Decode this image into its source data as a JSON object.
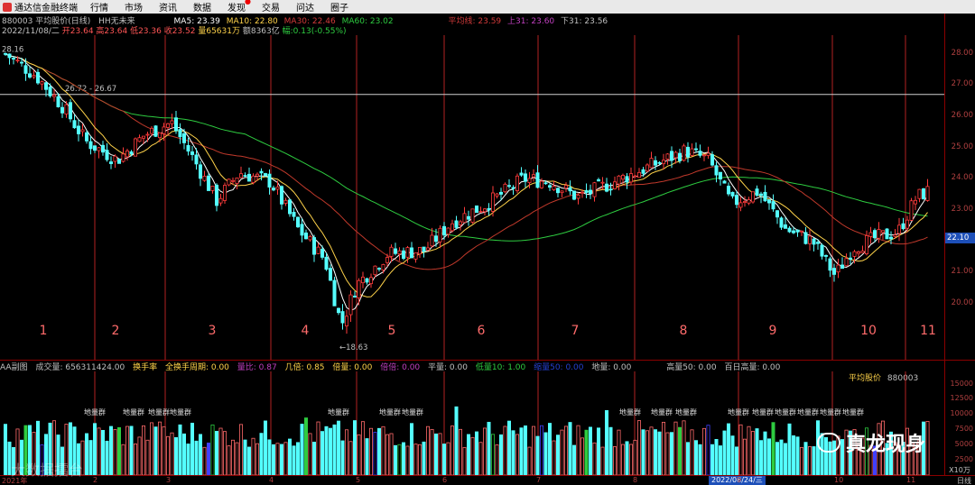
{
  "menubar": {
    "app_name": "通达信金融终端",
    "items": [
      "行情",
      "市场",
      "资讯",
      "数据",
      "发现",
      "交易",
      "问达",
      "圈子"
    ],
    "new_dot_item_index": 4
  },
  "info": {
    "code_name": "880003 平均股价(日线)",
    "hh_label": "HH无未来",
    "ma5": "MA5: 23.39",
    "ma10": "MA10: 22.80",
    "ma30": "MA30: 22.46",
    "ma60": "MA60: 23.02",
    "ping_jun": "平均线: 23.59",
    "shang31": "上31: 23.60",
    "xia31": "下31: 23.56",
    "date": "2022/11/08/二",
    "open": "开23.64",
    "high": "高23.64",
    "low": "低23.36",
    "close": "收23.52",
    "volume": "量65631万",
    "amount": "额8363亿",
    "change": "幅:0.13(-0.55%)"
  },
  "colors": {
    "up": "#ff3b3b",
    "down": "#54ffff",
    "ma5": "#ffffff",
    "ma10": "#ffd34a",
    "ma30": "#c0392b",
    "ma60": "#2ecc40",
    "vline": "#b22222",
    "hline": "#d0d0d0"
  },
  "price_axis": {
    "ticks": [
      "28.00",
      "27.00",
      "26.00",
      "25.00",
      "24.00",
      "23.00",
      "22.00",
      "21.00",
      "20.00"
    ],
    "current": "22.10"
  },
  "annotations": {
    "top_left": "28.16",
    "hline_label": "26.72 - 26.67",
    "low": "←18.63"
  },
  "sections": [
    "1",
    "2",
    "3",
    "4",
    "5",
    "6",
    "7",
    "8",
    "9",
    "10",
    "11"
  ],
  "vol_header": {
    "name": "AA副图",
    "amount": "成交量: 656311424.00",
    "turnover": "换手率",
    "full_cycle": "全换手周期: 0.00",
    "liang_bi": "量比: 0.87",
    "ji_bei": "几倍: 0.85",
    "bei_liang": "倍量: 0.00",
    "jia_bei": "倍倍: 0.00",
    "ping_liang": "平量: 0.00",
    "di_liang": "低量10: 1.00",
    "mid": "缩量50: 0.00",
    "di_liang2": "地量: 0.00",
    "gao_liang": "高量50: 0.00",
    "bai_ri": "百日高量: 0.00",
    "right_label": "平均股价",
    "right_code": "880003"
  },
  "vol_axis": {
    "ticks": [
      "15000",
      "12500",
      "10000",
      "7500",
      "5000",
      "2500"
    ],
    "scale": "X10万"
  },
  "dilianqun_label": "地量群",
  "date_axis": {
    "labels": [
      "2021年",
      "2",
      "3",
      "4",
      "5",
      "6",
      "7",
      "8",
      "9",
      "10",
      "11"
    ],
    "highlight": "2022/08/24/三",
    "mode": "日线"
  },
  "watermark": {
    "main": "真龙现身",
    "secondary": "大数据擂台"
  }
}
